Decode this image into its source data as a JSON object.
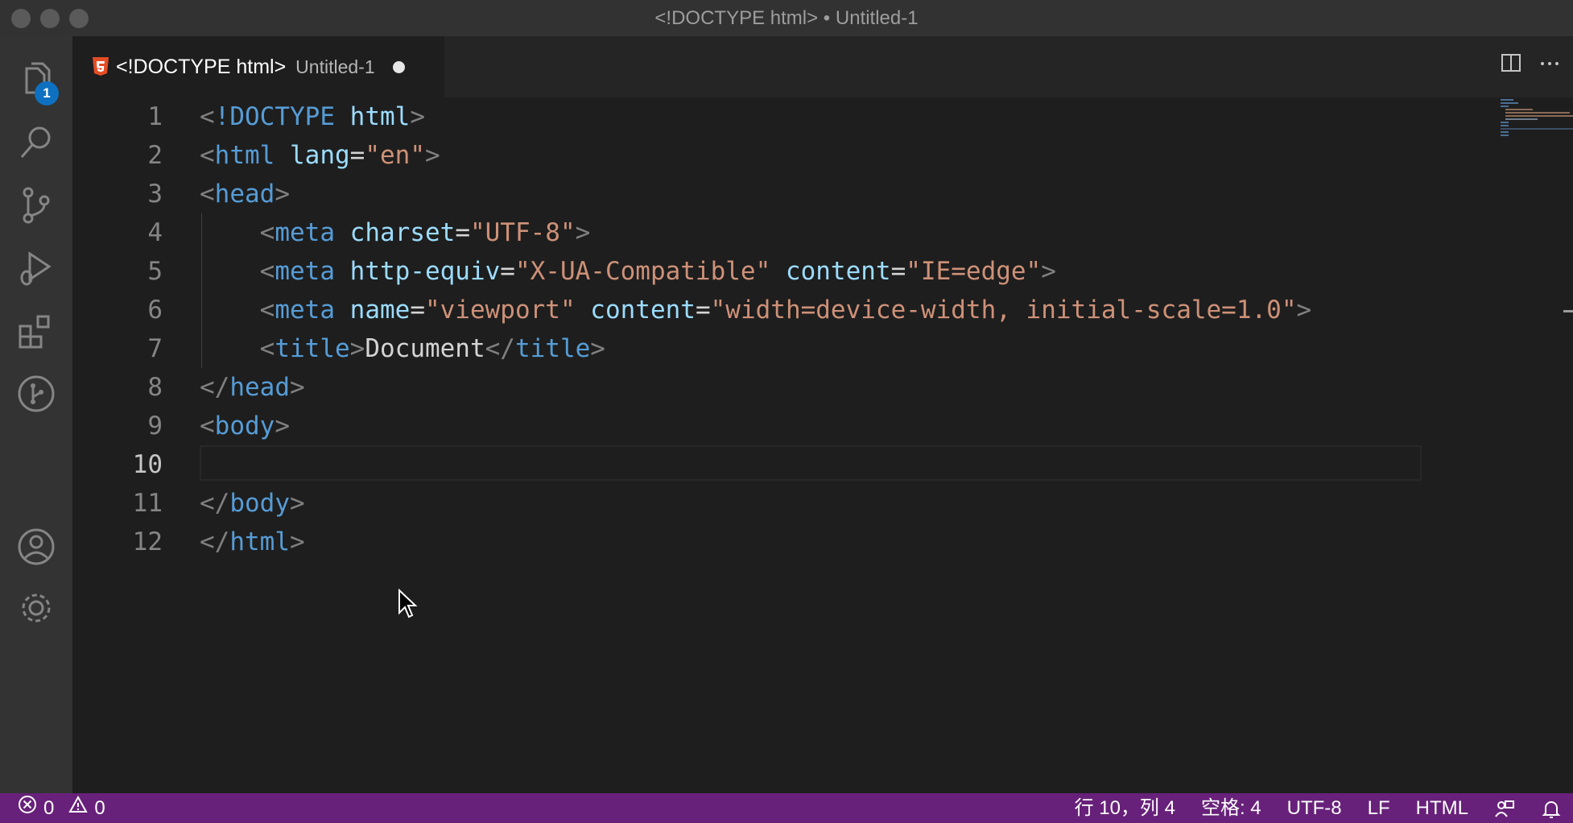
{
  "window": {
    "title": "<!DOCTYPE html> • Untitled-1"
  },
  "activity_bar": {
    "explorer_badge": "1",
    "icons": [
      "files-icon",
      "search-icon",
      "source-control-icon",
      "run-debug-icon",
      "extensions-icon",
      "git-graph-icon",
      "account-icon",
      "settings-gear-icon"
    ]
  },
  "tab": {
    "icon": "html5-icon",
    "title": "<!DOCTYPE html>",
    "description": "Untitled-1",
    "dirty": true
  },
  "editor": {
    "active_line": 10,
    "line_numbers": [
      "1",
      "2",
      "3",
      "4",
      "5",
      "6",
      "7",
      "8",
      "9",
      "10",
      "11",
      "12"
    ],
    "lines": [
      [
        [
          "br",
          "<"
        ],
        [
          "tag",
          "!DOCTYPE"
        ],
        [
          "txt",
          " "
        ],
        [
          "attr",
          "html"
        ],
        [
          "br",
          ">"
        ]
      ],
      [
        [
          "br",
          "<"
        ],
        [
          "tag",
          "html"
        ],
        [
          "txt",
          " "
        ],
        [
          "attr",
          "lang"
        ],
        [
          "txt",
          "="
        ],
        [
          "str",
          "\"en\""
        ],
        [
          "br",
          ">"
        ]
      ],
      [
        [
          "br",
          "<"
        ],
        [
          "tag",
          "head"
        ],
        [
          "br",
          ">"
        ]
      ],
      [
        [
          "txt",
          "    "
        ],
        [
          "br",
          "<"
        ],
        [
          "tag",
          "meta"
        ],
        [
          "txt",
          " "
        ],
        [
          "attr",
          "charset"
        ],
        [
          "txt",
          "="
        ],
        [
          "str",
          "\"UTF-8\""
        ],
        [
          "br",
          ">"
        ]
      ],
      [
        [
          "txt",
          "    "
        ],
        [
          "br",
          "<"
        ],
        [
          "tag",
          "meta"
        ],
        [
          "txt",
          " "
        ],
        [
          "attr",
          "http-equiv"
        ],
        [
          "txt",
          "="
        ],
        [
          "str",
          "\"X-UA-Compatible\""
        ],
        [
          "txt",
          " "
        ],
        [
          "attr",
          "content"
        ],
        [
          "txt",
          "="
        ],
        [
          "str",
          "\"IE=edge\""
        ],
        [
          "br",
          ">"
        ]
      ],
      [
        [
          "txt",
          "    "
        ],
        [
          "br",
          "<"
        ],
        [
          "tag",
          "meta"
        ],
        [
          "txt",
          " "
        ],
        [
          "attr",
          "name"
        ],
        [
          "txt",
          "="
        ],
        [
          "str",
          "\"viewport\""
        ],
        [
          "txt",
          " "
        ],
        [
          "attr",
          "content"
        ],
        [
          "txt",
          "="
        ],
        [
          "str",
          "\"width=device-width, initial-scale=1.0\""
        ],
        [
          "br",
          ">"
        ]
      ],
      [
        [
          "txt",
          "    "
        ],
        [
          "br",
          "<"
        ],
        [
          "tag",
          "title"
        ],
        [
          "br",
          ">"
        ],
        [
          "txt",
          "Document"
        ],
        [
          "br",
          "</"
        ],
        [
          "tag",
          "title"
        ],
        [
          "br",
          ">"
        ]
      ],
      [
        [
          "br",
          "</"
        ],
        [
          "tag",
          "head"
        ],
        [
          "br",
          ">"
        ]
      ],
      [
        [
          "br",
          "<"
        ],
        [
          "tag",
          "body"
        ],
        [
          "br",
          ">"
        ]
      ],
      [
        [
          "txt",
          "    "
        ]
      ],
      [
        [
          "br",
          "</"
        ],
        [
          "tag",
          "body"
        ],
        [
          "br",
          ">"
        ]
      ],
      [
        [
          "br",
          "</"
        ],
        [
          "tag",
          "html"
        ],
        [
          "br",
          ">"
        ]
      ]
    ]
  },
  "statusbar": {
    "errors": "0",
    "warnings": "0",
    "position": "行 10，列 4",
    "spaces": "空格: 4",
    "encoding": "UTF-8",
    "eol": "LF",
    "language": "HTML"
  },
  "colors": {
    "statusbar_bg": "#68217a",
    "badge_bg": "#0e70c0",
    "tag": "#569cd6",
    "attr": "#9cdcfe",
    "string": "#ce9178",
    "bracket": "#808080"
  }
}
